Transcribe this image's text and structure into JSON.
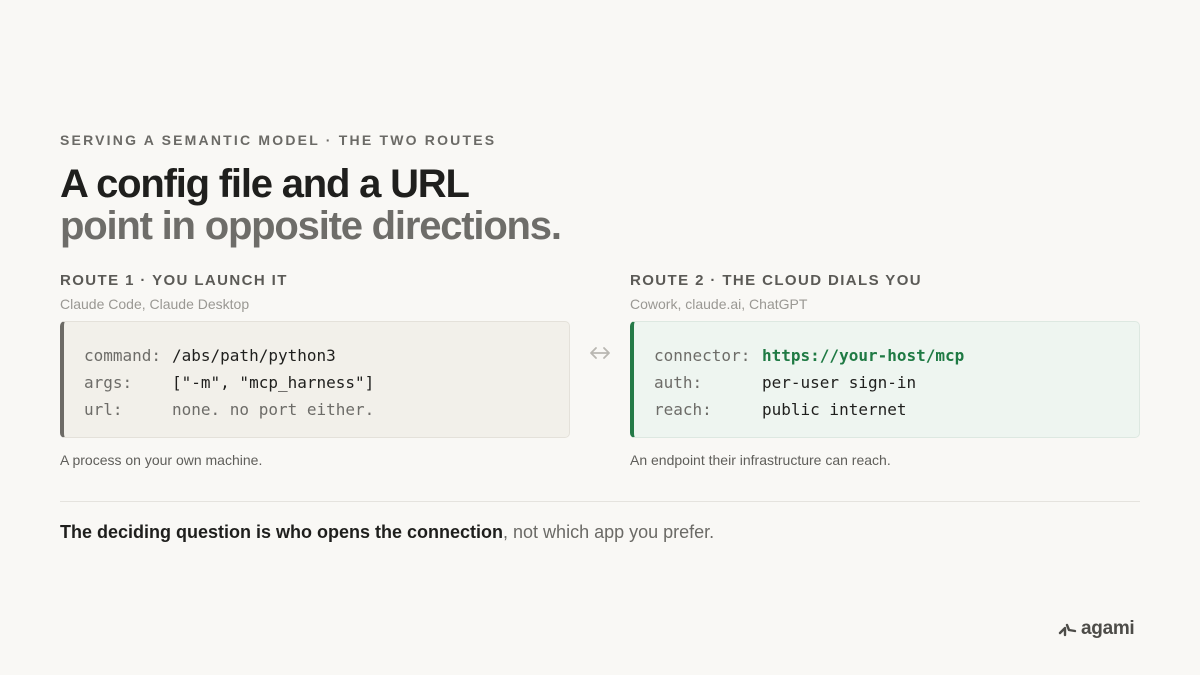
{
  "eyebrow": "SERVING A SEMANTIC MODEL · THE TWO ROUTES",
  "title": {
    "line1": "A config file and a URL",
    "line2": "point in opposite directions."
  },
  "routes": [
    {
      "label": "ROUTE 1 · YOU LAUNCH IT",
      "apps": "Claude Code, Claude Desktop",
      "code": [
        {
          "key": "command:",
          "value": "/abs/path/python3"
        },
        {
          "key": "args:",
          "value": "[\"-m\", \"mcp_harness\"]"
        },
        {
          "key": "url:",
          "value": "none. no port either."
        }
      ],
      "caption": "A process on your own machine."
    },
    {
      "label": "ROUTE 2 · THE CLOUD DIALS YOU",
      "apps": "Cowork, claude.ai, ChatGPT",
      "code": [
        {
          "key": "connector:",
          "value": "https://your-host/mcp"
        },
        {
          "key": "auth:",
          "value": "per-user sign-in"
        },
        {
          "key": "reach:",
          "value": "public internet"
        }
      ],
      "caption": "An endpoint their infrastructure can reach."
    }
  ],
  "takeaway": {
    "bold": "The deciding question is who opens the connection",
    "rest": ", not which app you prefer."
  },
  "logo": {
    "text": "agami",
    "icon": "agami-logo-icon"
  },
  "colors": {
    "background": "#f9f8f5",
    "route1_accent": "#6d6b66",
    "route2_accent": "#247a47",
    "url_text": "#1f7a44"
  }
}
